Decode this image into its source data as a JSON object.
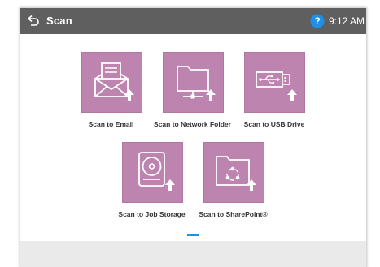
{
  "header": {
    "title": "Scan",
    "time": "9:12 AM"
  },
  "colors": {
    "topbar": "#5f5f5f",
    "tile": "#bd84af",
    "accent": "#1e90e8",
    "bottom_bar": "#eaeaea"
  },
  "tiles": [
    {
      "label": "Scan to Email",
      "icon": "envelope-icon"
    },
    {
      "label": "Scan to Network Folder",
      "icon": "network-folder-icon"
    },
    {
      "label": "Scan to USB Drive",
      "icon": "usb-drive-icon"
    },
    {
      "label": "Scan to Job Storage",
      "icon": "job-storage-icon"
    },
    {
      "label": "Scan to SharePoint®",
      "icon": "sharepoint-icon"
    }
  ],
  "pagination": {
    "current_page": 1,
    "page_count": 1
  }
}
